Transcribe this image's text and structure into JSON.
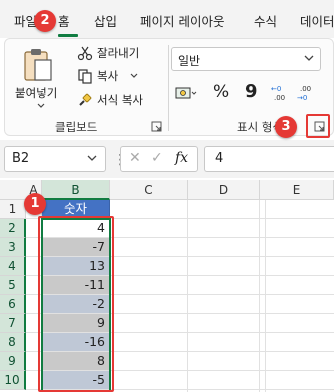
{
  "ribbon_tabs": [
    "파일",
    "홈",
    "삽입",
    "페이지 레이아웃",
    "수식",
    "데이터"
  ],
  "active_tab": "홈",
  "clipboard": {
    "paste_label": "붙여넣기",
    "cut_label": "잘라내기",
    "copy_label": "복사",
    "format_painter_label": "서식 복사",
    "group_label": "클립보드"
  },
  "number": {
    "format_value": "일반",
    "group_label": "표시 형식",
    "percent_symbol": "%",
    "comma_symbol": "9",
    "increase_decimal": "←0\n.00",
    "decrease_decimal": ".00\n→0"
  },
  "formula_bar": {
    "name_box": "B2",
    "cancel_symbol": "✕",
    "enter_symbol": "✓",
    "fx_symbol": "fx",
    "value": "4"
  },
  "grid": {
    "columns": [
      "A",
      "B",
      "C",
      "D",
      "E"
    ],
    "rows": [
      "1",
      "2",
      "3",
      "4",
      "5",
      "6",
      "7",
      "8",
      "9",
      "10"
    ],
    "header_cell": "숫자",
    "values": [
      "4",
      "-7",
      "13",
      "-11",
      "-2",
      "9",
      "-16",
      "8",
      "-5"
    ]
  },
  "badges": [
    "1",
    "2",
    "3"
  ],
  "colors": {
    "accent_green": "#107c41",
    "header_blue": "#4472c4",
    "annotation_red": "#e53935"
  }
}
